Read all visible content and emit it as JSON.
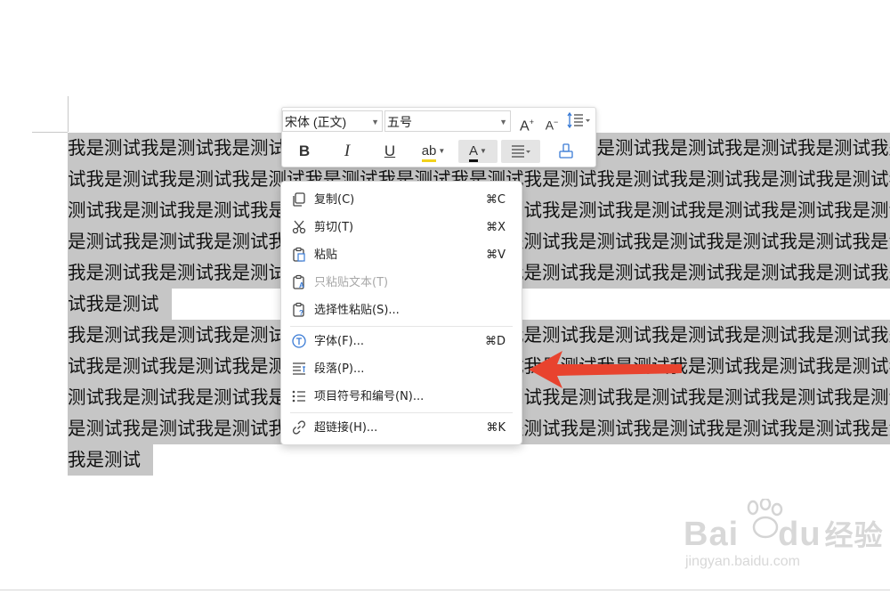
{
  "document": {
    "lines": [
      {
        "text": "我是测试我是测试我是测试我是测试我是测试我是测试我是测试我是测试我是测试我是测试我是测试我是测试",
        "full": true
      },
      {
        "text": "试我是测试我是测试我是测试我是测试我是测试我是测试我是测试我是测试我是测试我是测试我是测试我是测",
        "full": true
      },
      {
        "text": "测试我是测试我是测试我是测试我是测试我是测试我是测试我是测试我是测试我是测试我是测试我是测试我是",
        "full": true
      },
      {
        "text": "是测试我是测试我是测试我是测试我是测试我是测试我是测试我是测试我是测试我是测试我是测试我是测试我",
        "full": true
      },
      {
        "text": "我是测试我是测试我是测试我是测试我是测试我是测试我是测试我是测试我是测试我是测试我是测试我是测试",
        "full": true
      },
      {
        "text": "试我是测试",
        "full": false
      },
      {
        "text": "我是测试我是测试我是测试我是测试我是测试我是测试我是测试我是测试我是测试我是测试我是测试我是测试",
        "full": true
      },
      {
        "text": "试我是测试我是测试我是测试我是测试我是测试我是测试我是测试我是测试我是测试我是测试我是测试我是测",
        "full": true
      },
      {
        "text": "测试我是测试我是测试我是测试我是测试我是测试我是测试我是测试我是测试我是测试我是测试我是测试我是",
        "full": true
      },
      {
        "text": "是测试我是测试我是测试我是测试我是测试我是测试我是测试我是测试我是测试我是测试我是测试我是测试我",
        "full": true
      },
      {
        "text": "我是测试",
        "full": false
      }
    ]
  },
  "mini_toolbar": {
    "font_name": "宋体 (正文)",
    "font_size": "五号",
    "grow_label": "A",
    "shrink_label": "A",
    "bold": "B",
    "italic": "I",
    "underline": "U",
    "highlight": "ab",
    "font_color": "A",
    "highlight_color": "#f2d21b",
    "font_color_bar": "#111111"
  },
  "context_menu": {
    "items": [
      {
        "label": "复制(C)",
        "shortcut": "⌘C",
        "icon": "copy-icon",
        "disabled": false
      },
      {
        "label": "剪切(T)",
        "shortcut": "⌘X",
        "icon": "scissors-icon",
        "disabled": false
      },
      {
        "label": "粘贴",
        "shortcut": "⌘V",
        "icon": "paste-icon",
        "disabled": false
      },
      {
        "label": "只粘贴文本(T)",
        "shortcut": "",
        "icon": "paste-text-icon",
        "disabled": true
      },
      {
        "label": "选择性粘贴(S)...",
        "shortcut": "",
        "icon": "paste-special-icon",
        "disabled": false
      },
      {
        "label": "字体(F)...",
        "shortcut": "⌘D",
        "icon": "font-icon",
        "disabled": false
      },
      {
        "label": "段落(P)...",
        "shortcut": "",
        "icon": "paragraph-icon",
        "disabled": false
      },
      {
        "label": "项目符号和编号(N)...",
        "shortcut": "",
        "icon": "list-icon",
        "disabled": false
      },
      {
        "label": "超链接(H)...",
        "shortcut": "⌘K",
        "icon": "link-icon",
        "disabled": false
      }
    ]
  },
  "annotation": {
    "arrow_color": "#e8432e"
  },
  "watermark": {
    "logo_left": "Bai",
    "logo_right": "du",
    "logo_cn": "经验",
    "url": "jingyan.baidu.com"
  }
}
